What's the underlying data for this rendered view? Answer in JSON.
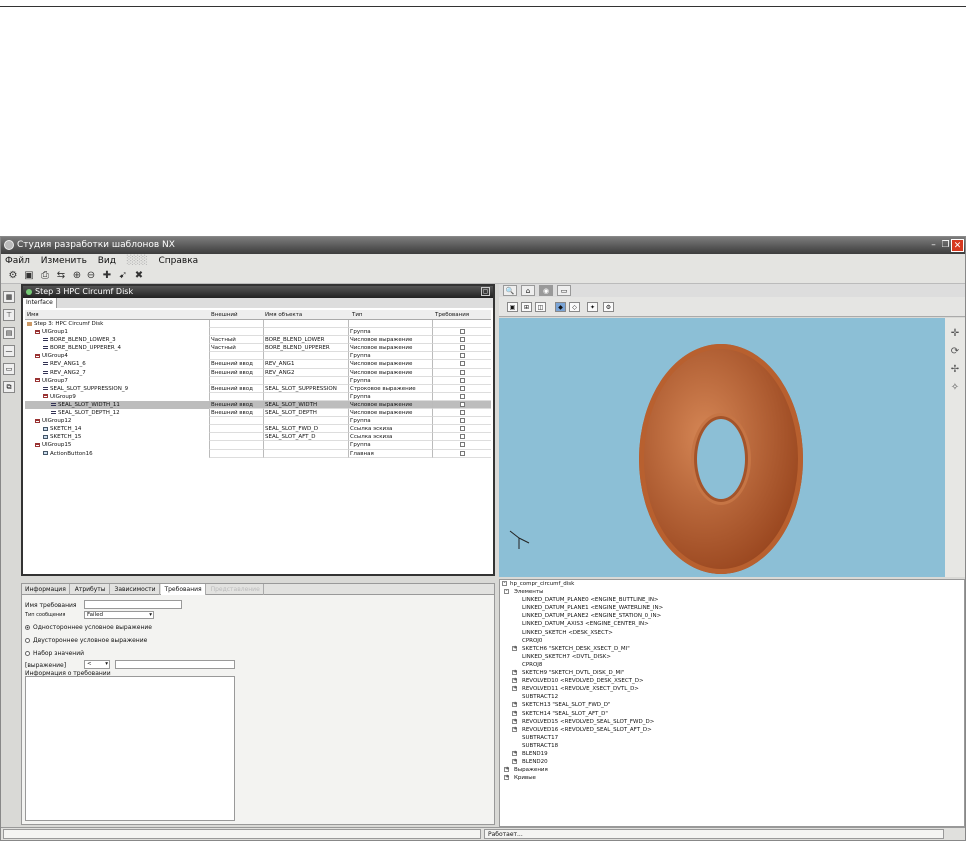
{
  "window": {
    "title": "Студия разработки шаблонов NX"
  },
  "menu": [
    "Файл",
    "Изменить",
    "Вид",
    "Справка"
  ],
  "panel": {
    "title": "Step 3  HPC Circumf Disk",
    "tab": "Interface",
    "columns": [
      "Имя",
      "Внешний",
      "Имя объекта",
      "Тип",
      "Требования"
    ],
    "rows": [
      {
        "name": "Step 3: HPC Circumf Disk",
        "ext": "",
        "obj": "",
        "type": "",
        "ind": 0,
        "icon": "fld"
      },
      {
        "name": "UIGroup1",
        "ext": "",
        "obj": "",
        "type": "Группа",
        "ind": 1,
        "icon": "grp"
      },
      {
        "name": "BORE_BLEND_LOWER_3",
        "ext": "Частный",
        "obj": "BORE_BLEND_LOWER",
        "type": "Числовое выражение",
        "ind": 2,
        "icon": "eq"
      },
      {
        "name": "BORE_BLEND_UPPERER_4",
        "ext": "Частный",
        "obj": "BORE_BLEND_UPPERER",
        "type": "Числовое выражение",
        "ind": 2,
        "icon": "eq"
      },
      {
        "name": "UIGroup4",
        "ext": "",
        "obj": "",
        "type": "Группа",
        "ind": 1,
        "icon": "grp"
      },
      {
        "name": "REV_ANG1_6",
        "ext": "Внешний ввод",
        "obj": "REV_ANG1",
        "type": "Числовое выражение",
        "ind": 2,
        "icon": "eq"
      },
      {
        "name": "REV_ANG2_7",
        "ext": "Внешний ввод",
        "obj": "REV_ANG2",
        "type": "Числовое выражение",
        "ind": 2,
        "icon": "eq"
      },
      {
        "name": "UIGroup7",
        "ext": "",
        "obj": "",
        "type": "Группа",
        "ind": 1,
        "icon": "grp"
      },
      {
        "name": "SEAL_SLOT_SUPPRESSION_9",
        "ext": "Внешний ввод",
        "obj": "SEAL_SLOT_SUPPRESSION",
        "type": "Строковое выражение",
        "ind": 2,
        "icon": "eq"
      },
      {
        "name": "UIGroup9",
        "ext": "",
        "obj": "",
        "type": "Группа",
        "ind": 2,
        "icon": "grp"
      },
      {
        "name": "SEAL_SLOT_WIDTH_11",
        "ext": "Внешний ввод",
        "obj": "SEAL_SLOT_WIDTH",
        "type": "Числовое выражение",
        "ind": 3,
        "icon": "eq"
      },
      {
        "name": "SEAL_SLOT_DEPTH_12",
        "ext": "Внешний ввод",
        "obj": "SEAL_SLOT_DEPTH",
        "type": "Числовое выражение",
        "ind": 3,
        "icon": "eq"
      },
      {
        "name": "UIGroup12",
        "ext": "",
        "obj": "",
        "type": "Группа",
        "ind": 1,
        "icon": "grp"
      },
      {
        "name": "SKETCH_14",
        "ext": "",
        "obj": "SEAL_SLOT_FWD_D",
        "type": "Ссылка эскиза",
        "ind": 2,
        "icon": "sk"
      },
      {
        "name": "SKETCH_15",
        "ext": "",
        "obj": "SEAL_SLOT_AFT_D",
        "type": "Ссылка эскиза",
        "ind": 2,
        "icon": "sk"
      },
      {
        "name": "UIGroup15",
        "ext": "",
        "obj": "",
        "type": "Группа",
        "ind": 1,
        "icon": "grp"
      },
      {
        "name": "ActionButton16",
        "ext": "",
        "obj": "",
        "type": "Главная",
        "ind": 2,
        "icon": "sk"
      }
    ],
    "selected_row": 10
  },
  "lower": {
    "tabs": [
      "Информация",
      "Атрибуты",
      "Зависимости",
      "Требования",
      "Представление"
    ],
    "active_tab": "Требования",
    "req_name_label": "Имя требования",
    "msg_type_label": "Тип сообщения",
    "msg_type_value": "Failed",
    "radios": [
      "Одностороннее условное выражение",
      "Двустороннее условное выражение",
      "Набор значений"
    ],
    "expr_label": "[выражение]",
    "expr_op": "<",
    "info_label": "Информация о требовании"
  },
  "tree": {
    "root": "hp_compr_circumf_disk",
    "items": [
      {
        "t": "Элементы",
        "ind": 1,
        "ex": "-"
      },
      {
        "t": "LINKED_DATUM_PLANE0 <ENGINE_BUTTLINE_IN>",
        "ind": 2,
        "ex": ""
      },
      {
        "t": "LINKED_DATUM_PLANE1 <ENGINE_WATERLINE_IN>",
        "ind": 2,
        "ex": ""
      },
      {
        "t": "LINKED_DATUM_PLANE2 <ENGINE_STATION_0_IN>",
        "ind": 2,
        "ex": ""
      },
      {
        "t": "LINKED_DATUM_AXIS3 <ENGINE_CENTER_IN>",
        "ind": 2,
        "ex": ""
      },
      {
        "t": "LINKED_SKETCH <DESK_XSECT>",
        "ind": 2,
        "ex": ""
      },
      {
        "t": "CPROJ0",
        "ind": 2,
        "ex": ""
      },
      {
        "t": "SKETCH6 \"SKETCH_DESK_XSECT_D_MI\"",
        "ind": 2,
        "ex": "+"
      },
      {
        "t": "LINKED_SKETCH7 <DVTL_DISK>",
        "ind": 2,
        "ex": ""
      },
      {
        "t": "CPROJ8",
        "ind": 2,
        "ex": ""
      },
      {
        "t": "SKETCH9 \"SKETCH_DVTL_DISK_D_MI\"",
        "ind": 2,
        "ex": "+"
      },
      {
        "t": "REVOLVED10 <REVOLVED_DESK_XSECT_D>",
        "ind": 2,
        "ex": "+"
      },
      {
        "t": "REVOLVED11 <REVOLVE_XSECT_DVTL_D>",
        "ind": 2,
        "ex": "+"
      },
      {
        "t": "SUBTRACT12",
        "ind": 2,
        "ex": ""
      },
      {
        "t": "SKETCH13 \"SEAL_SLOT_FWD_D\"",
        "ind": 2,
        "ex": "+"
      },
      {
        "t": "SKETCH14 \"SEAL_SLOT_AFT_D\"",
        "ind": 2,
        "ex": "+"
      },
      {
        "t": "REVOLVED15 <REVOLVED_SEAL_SLOT_FWD_D>",
        "ind": 2,
        "ex": "+"
      },
      {
        "t": "REVOLVED16 <REVOLVED_SEAL_SLOT_AFT_D>",
        "ind": 2,
        "ex": "+"
      },
      {
        "t": "SUBTRACT17",
        "ind": 2,
        "ex": ""
      },
      {
        "t": "SUBTRACT18",
        "ind": 2,
        "ex": ""
      },
      {
        "t": "BLEND19",
        "ind": 2,
        "ex": "+"
      },
      {
        "t": "BLEND20",
        "ind": 2,
        "ex": "+"
      },
      {
        "t": "Выражения",
        "ind": 1,
        "ex": "+"
      },
      {
        "t": "Кривые",
        "ind": 1,
        "ex": "+"
      }
    ]
  },
  "status": {
    "right": "Работает..."
  },
  "colors": {
    "viewport": "#8cbfd6",
    "disk": "#a4542a",
    "close": "#d6381f"
  }
}
